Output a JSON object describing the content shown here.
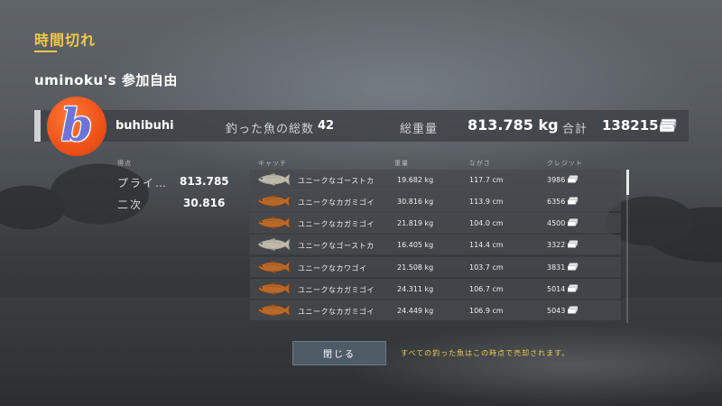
{
  "title": "時間切れ",
  "subtitle": "uminoku's 参加自由",
  "player": {
    "avatar_letter": "b",
    "name": "buhibuhi",
    "catch_label": "釣った魚の総数",
    "catch_count": "42",
    "weight_label": "総重量",
    "weight_value": "813.785 kg",
    "total_label": "合計",
    "total_value": "138215",
    "money_icon": "money-stack-icon"
  },
  "scores": {
    "header": "得点",
    "rows": [
      {
        "label": "プライ…",
        "value": "813.785"
      },
      {
        "label": "二次",
        "value": "30.816"
      }
    ]
  },
  "table": {
    "headers": {
      "catch": "キャッチ",
      "weight": "重量",
      "length": "ながさ",
      "credit": "クレジット"
    },
    "rows": [
      {
        "fish_type": "ghost",
        "name": "ユニークなゴーストカ",
        "weight": "19.682 kg",
        "length": "117.7 cm",
        "credit": "3986"
      },
      {
        "fish_type": "carp",
        "name": "ユニークなカガミゴイ",
        "weight": "30.816 kg",
        "length": "113.9 cm",
        "credit": "6356"
      },
      {
        "fish_type": "carp",
        "name": "ユニークなカガミゴイ",
        "weight": "21.819 kg",
        "length": "104.0 cm",
        "credit": "4500"
      },
      {
        "fish_type": "ghost",
        "name": "ユニークなゴーストカ",
        "weight": "16.405 kg",
        "length": "114.4 cm",
        "credit": "3322"
      },
      {
        "fish_type": "carp",
        "name": "ユニークなカワゴイ",
        "weight": "21.508 kg",
        "length": "103.7 cm",
        "credit": "3831"
      },
      {
        "fish_type": "carp",
        "name": "ユニークなカガミゴイ",
        "weight": "24.311 kg",
        "length": "106.7 cm",
        "credit": "5014"
      },
      {
        "fish_type": "carp",
        "name": "ユニークなカガミゴイ",
        "weight": "24.449 kg",
        "length": "106.9 cm",
        "credit": "5043"
      }
    ]
  },
  "footer": {
    "close_label": "閉じる",
    "note": "すべての釣った魚はこの時点で売却されます。"
  },
  "colors": {
    "accent": "#f1c84b",
    "avatar_bg": "#f0541a",
    "avatar_letter": "#6d74d9"
  }
}
